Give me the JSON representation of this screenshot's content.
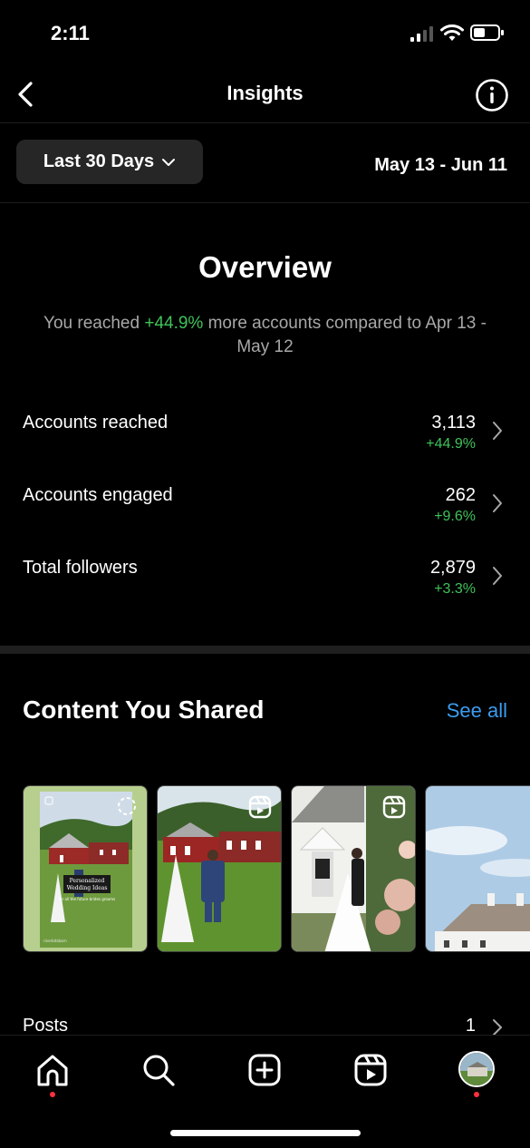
{
  "status_bar": {
    "time": "2:11"
  },
  "header": {
    "title": "Insights"
  },
  "period": {
    "label": "Last 30 Days",
    "date_range": "May 13 - Jun 11"
  },
  "overview": {
    "title": "Overview",
    "desc_prefix": "You reached ",
    "desc_highlight": "+44.9%",
    "desc_suffix": " more accounts compared to Apr 13 - May 12"
  },
  "metrics": [
    {
      "label": "Accounts reached",
      "value": "3,113",
      "change": "+44.9%"
    },
    {
      "label": "Accounts engaged",
      "value": "262",
      "change": "+9.6%"
    },
    {
      "label": "Total followers",
      "value": "2,879",
      "change": "+3.3%"
    }
  ],
  "content_shared": {
    "title": "Content You Shared",
    "see_all": "See all",
    "thumb_overlay_line1": "Personalized",
    "thumb_overlay_line2": "Wedding Ideas",
    "thumb_overlay_line3": "for all the future brides grooms",
    "thumb_watermark": "riverbitsbarn"
  },
  "posts": {
    "label": "Posts",
    "count": "1"
  },
  "tab_bar": {
    "items": [
      "home-icon",
      "search-icon",
      "create-icon",
      "reels-icon",
      "profile-avatar"
    ]
  },
  "colors": {
    "accent_green": "#3fc35a",
    "link_blue": "#3b9cf0",
    "notification_red": "#ff3040"
  }
}
